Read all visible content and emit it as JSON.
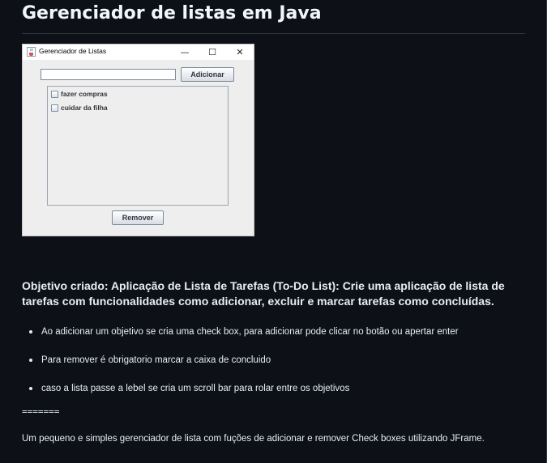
{
  "readme": {
    "title": "Gerenciador de listas em Java",
    "objective": "Objetivo criado: Aplicação de Lista de Tarefas (To-Do List): Crie uma aplicação de lista de tarefas com funcionalidades como adicionar, excluir e marcar tarefas como concluídas.",
    "bullets": [
      "Ao adicionar um objetivo se cria uma check box, para adicionar pode clicar no botão ou apertar enter",
      "Para remover é obrigatorio marcar a caixa de concluido",
      "caso a lista passe a lebel se cria um scroll bar para rolar entre os objetivos"
    ],
    "separator": "=======",
    "footer": "Um pequeno e simples gerenciador de lista com fuções de adicionar e remover Check boxes utilizando JFrame."
  },
  "app_window": {
    "title": "Gerenciador de Listas",
    "icon": "java-cup-icon",
    "controls": {
      "minimize": "—",
      "maximize": "☐",
      "close": "✕"
    },
    "input_value": "",
    "add_label": "Adicionar",
    "remove_label": "Remover",
    "items": [
      {
        "label": "fazer compras",
        "checked": false
      },
      {
        "label": "cuidar da filha",
        "checked": false
      }
    ]
  }
}
